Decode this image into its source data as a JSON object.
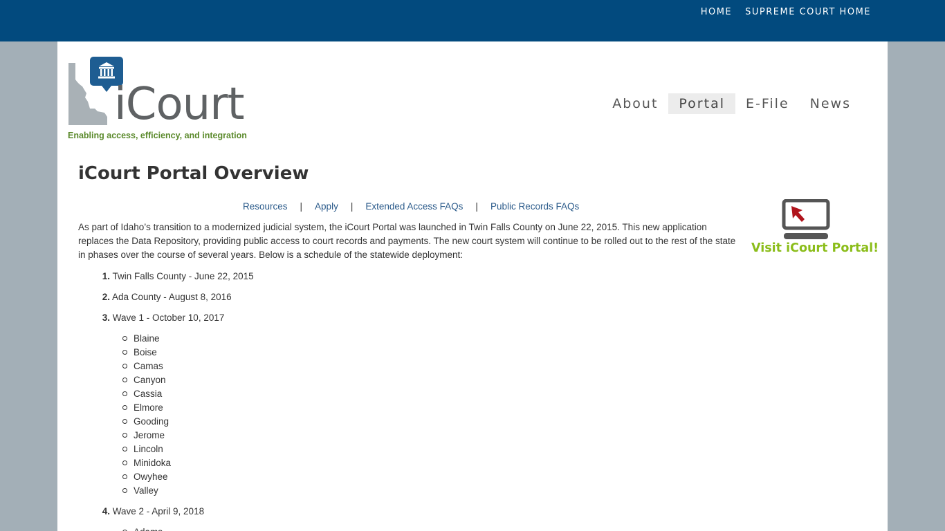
{
  "topnav": {
    "home": "HOME",
    "supreme": "SUPREME COURT HOME"
  },
  "logo": {
    "wordmark": "iCourt",
    "tagline": "Enabling access, efficiency, and integration"
  },
  "mainnav": {
    "about": "About",
    "portal": "Portal",
    "efile": "E-File",
    "news": "News",
    "active": "Portal"
  },
  "page": {
    "title": "iCourt Portal Overview"
  },
  "sublinks": {
    "resources": "Resources",
    "apply": "Apply",
    "extended": "Extended Access FAQs",
    "public": "Public Records FAQs",
    "sep": "|"
  },
  "intro": "As part of Idaho’s transition to a modernized judicial system, the iCourt Portal was launched in Twin Falls County on June 22, 2015. This new application replaces the Data Repository, providing public access to court records and payments. The new court system will continue to be rolled out to the rest of the state in phases over the course of several years. Below is a schedule of the statewide deployment:",
  "schedule": [
    {
      "num": "1.",
      "text": "Twin Falls County - June 22, 2015"
    },
    {
      "num": "2.",
      "text": "Ada County - August 8, 2016"
    },
    {
      "num": "3.",
      "text": "Wave 1 - October 10, 2017",
      "counties": [
        "Blaine",
        "Boise",
        "Camas",
        "Canyon",
        "Cassia",
        "Elmore",
        "Gooding",
        "Jerome",
        "Lincoln",
        "Minidoka",
        "Owyhee",
        "Valley"
      ]
    },
    {
      "num": "4.",
      "text": "Wave 2 - April 9, 2018",
      "counties": [
        "Adams"
      ]
    }
  ],
  "cta": {
    "label": "Visit iCourt Portal!"
  },
  "colors": {
    "topbar": "#024a7e",
    "background": "#a3afb7",
    "link": "#2a5a8a",
    "cta": "#8bbd1a",
    "tagline": "#5b8a2c"
  }
}
